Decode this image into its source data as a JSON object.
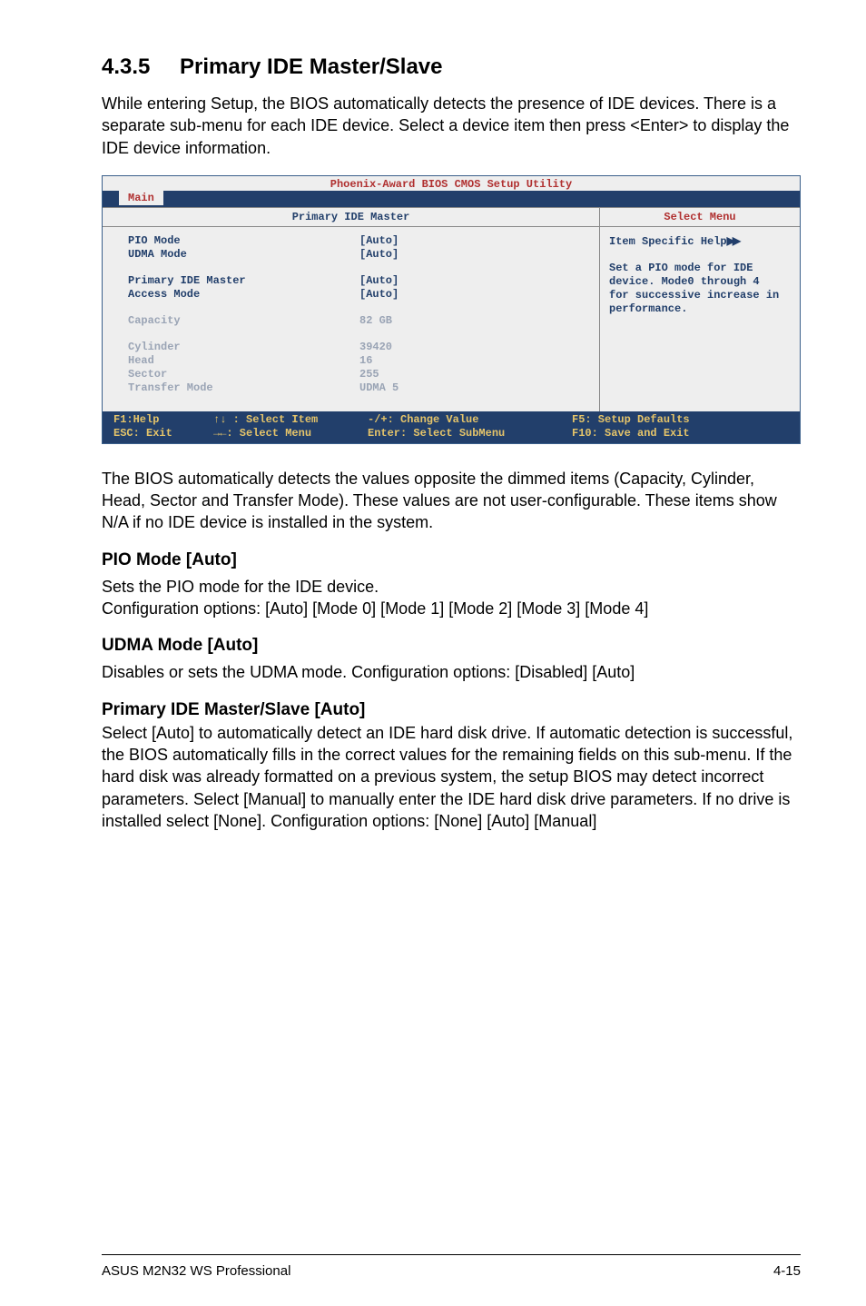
{
  "heading": {
    "number": "4.3.5",
    "title": "Primary IDE Master/Slave"
  },
  "intro": "While entering Setup, the BIOS automatically detects the presence of IDE devices. There is a separate sub-menu for each IDE device. Select a device item then press <Enter> to display the IDE device information.",
  "bios": {
    "title": "Phoenix-Award BIOS CMOS Setup Utility",
    "tab": "Main",
    "left_header": "Primary IDE Master",
    "right_header": "Select Menu",
    "items": {
      "pio_mode": {
        "label": "PIO Mode",
        "value": "[Auto]"
      },
      "udma_mode": {
        "label": "UDMA Mode",
        "value": "[Auto]"
      },
      "pri_master": {
        "label": "Primary IDE Master",
        "value": "[Auto]"
      },
      "access": {
        "label": "Access Mode",
        "value": "[Auto]"
      },
      "capacity": {
        "label": "Capacity",
        "value": "82 GB"
      },
      "cylinder": {
        "label": "Cylinder",
        "value": "39420"
      },
      "head": {
        "label": "Head",
        "value": "16"
      },
      "sector": {
        "label": "Sector",
        "value": "255"
      },
      "transfer": {
        "label": "Transfer Mode",
        "value": "UDMA 5"
      }
    },
    "help": {
      "title": "Item Specific Help",
      "l1": "Set a PIO mode for IDE",
      "l2": "device. Mode0 through 4",
      "l3": "for successive increase in",
      "l4": "performance."
    },
    "footer": {
      "f1": "F1:Help",
      "sel_item": "↑↓ : Select Item",
      "chg": "-/+: Change Value",
      "setup": "F5: Setup Defaults",
      "esc": "ESC: Exit",
      "sel_menu": "→←: Select Menu",
      "sub": "Enter: Select SubMenu",
      "save": "F10: Save and Exit"
    }
  },
  "para2": "The BIOS automatically detects the values opposite the dimmed items (Capacity, Cylinder,  Head, Sector and Transfer Mode). These values are not user-configurable. These items show N/A if no IDE device is installed in the system.",
  "pio": {
    "heading": "PIO Mode [Auto]",
    "l1": "Sets the PIO mode for the IDE device.",
    "l2": "Configuration options: [Auto] [Mode 0] [Mode 1] [Mode 2] [Mode 3] [Mode 4]"
  },
  "udma": {
    "heading": "UDMA Mode [Auto]",
    "l1": "Disables or sets the UDMA mode. Configuration options: [Disabled] [Auto]"
  },
  "prim": {
    "heading": "Primary IDE Master/Slave [Auto]",
    "body": "Select [Auto] to automatically detect an IDE hard disk drive. If automatic detection is successful, the BIOS automatically fills in the correct values for the remaining fields on this sub-menu. If the hard disk was already formatted on a previous system, the setup BIOS may detect incorrect parameters. Select [Manual] to manually enter the IDE hard disk drive parameters. If no drive is installed select [None]. Configuration options: [None] [Auto] [Manual]"
  },
  "footer": {
    "left": "ASUS M2N32 WS Professional",
    "right": "4-15"
  }
}
